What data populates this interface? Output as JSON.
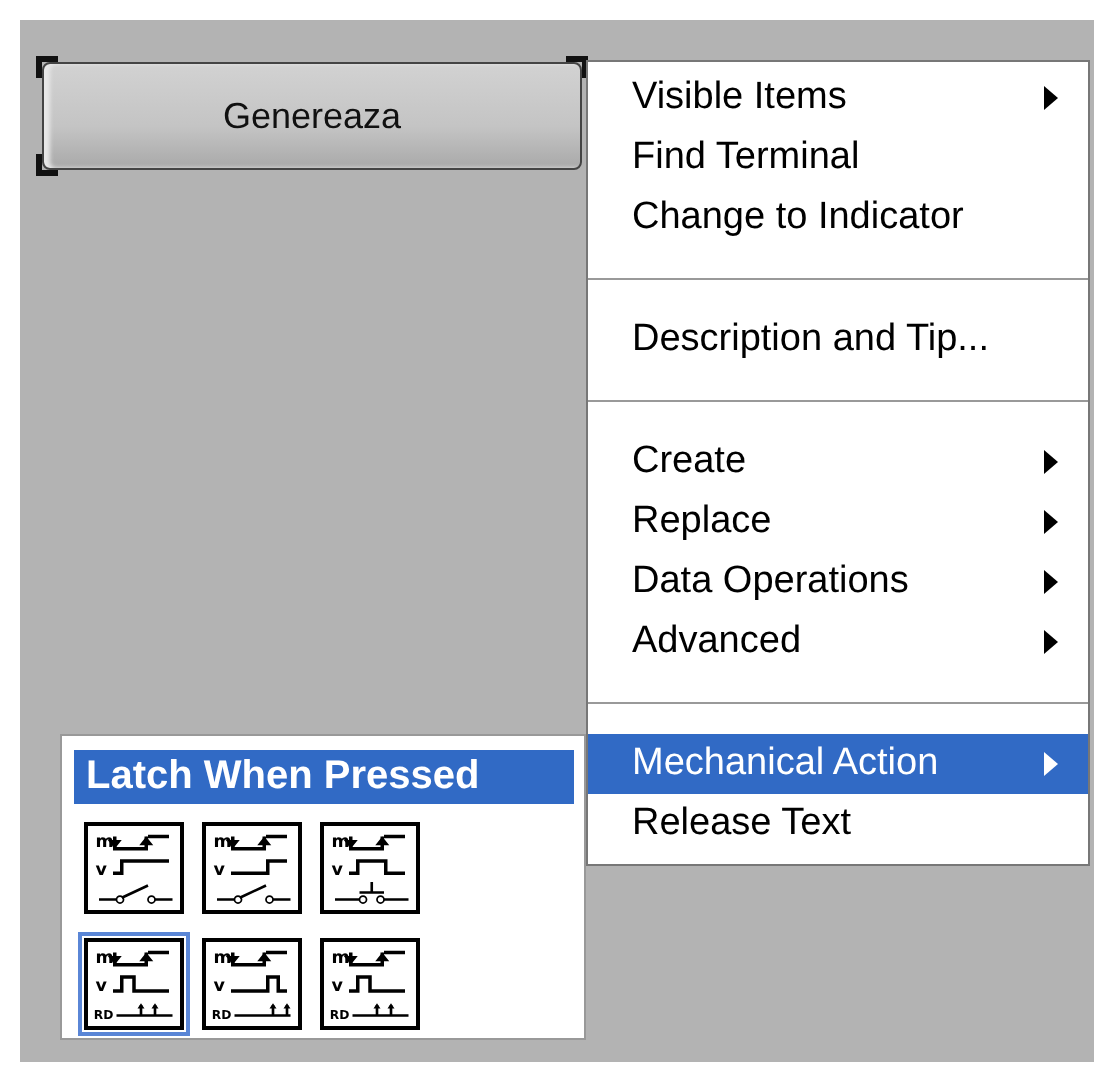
{
  "button": {
    "label": "Genereaza",
    "selected": true
  },
  "menu": {
    "items": [
      {
        "kind": "item",
        "label": "Visible Items",
        "submenu": true,
        "selected": false
      },
      {
        "kind": "item",
        "label": "Find Terminal",
        "submenu": false,
        "selected": false
      },
      {
        "kind": "item",
        "label": "Change to Indicator",
        "submenu": false,
        "selected": false
      },
      {
        "kind": "separator"
      },
      {
        "kind": "item",
        "label": "Description and Tip...",
        "submenu": false,
        "selected": false
      },
      {
        "kind": "separator"
      },
      {
        "kind": "item",
        "label": "Create",
        "submenu": true,
        "selected": false
      },
      {
        "kind": "item",
        "label": "Replace",
        "submenu": true,
        "selected": false
      },
      {
        "kind": "item",
        "label": "Data Operations",
        "submenu": true,
        "selected": false
      },
      {
        "kind": "item",
        "label": "Advanced",
        "submenu": true,
        "selected": false
      },
      {
        "kind": "separator"
      },
      {
        "kind": "item",
        "label": "Mechanical Action",
        "submenu": true,
        "selected": true
      },
      {
        "kind": "item",
        "label": "Release Text",
        "submenu": false,
        "selected": false
      }
    ]
  },
  "palette": {
    "title": "Latch When Pressed",
    "options": [
      {
        "kind": "switch-pressed",
        "marks": [
          "m",
          "v"
        ],
        "selected": false
      },
      {
        "kind": "switch-released",
        "marks": [
          "m",
          "v"
        ],
        "selected": false
      },
      {
        "kind": "switch-until",
        "marks": [
          "m",
          "v"
        ],
        "selected": false
      },
      {
        "kind": "latch-pressed",
        "marks": [
          "m",
          "v",
          "RD"
        ],
        "selected": true
      },
      {
        "kind": "latch-released",
        "marks": [
          "m",
          "v",
          "RD"
        ],
        "selected": false
      },
      {
        "kind": "latch-until",
        "marks": [
          "m",
          "v",
          "RD"
        ],
        "selected": false
      }
    ]
  }
}
